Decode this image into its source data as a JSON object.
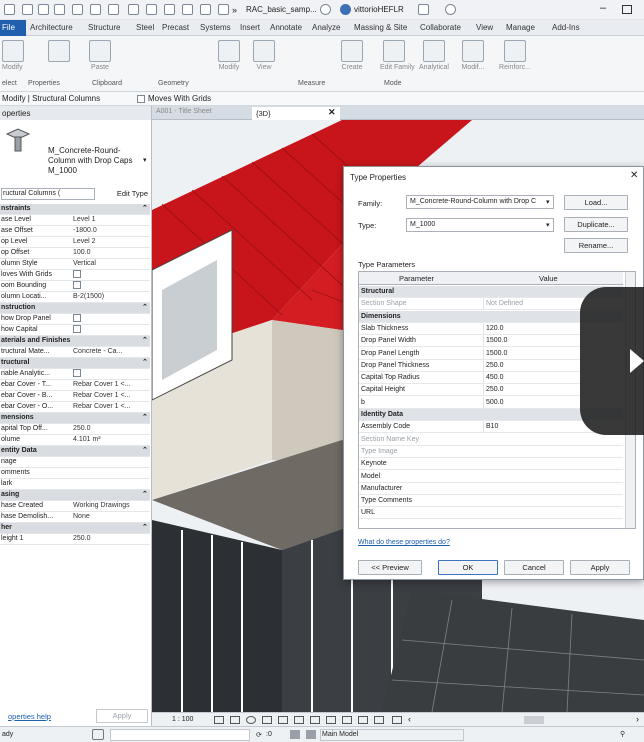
{
  "title_bar": {
    "doc_title": "RAC_basic_samp...",
    "user": "vittorioHEFLR"
  },
  "ribbon": {
    "tabs": [
      "File",
      "Architecture",
      "Structure",
      "Steel",
      "Precast",
      "Systems",
      "Insert",
      "Annotate",
      "Analyze",
      "Massing & Site",
      "Collaborate",
      "View",
      "Manage",
      "Add-Ins"
    ],
    "buttons": [
      "Modify",
      "Paste",
      "Modify",
      "View",
      "Create",
      "Edit Family",
      "Analytical",
      "Modif...",
      "Reinforc..."
    ],
    "groups": [
      "elect",
      "Properties",
      "Clipboard",
      "Geometry",
      "Measure",
      "Mode"
    ]
  },
  "context_bar": {
    "label": "Modify | Structural Columns",
    "option": "Moves With Grids"
  },
  "properties": {
    "header": "operties",
    "family_line1": "M_Concrete-Round-",
    "family_line2": "Column with Drop Caps",
    "family_line3": "M_1000",
    "filter": "ructural Columns (",
    "edit_type": "Edit Type",
    "rows": [
      {
        "label": "nstraints",
        "value": "",
        "kind": "hdr"
      },
      {
        "label": "ase Level",
        "value": "Level 1"
      },
      {
        "label": "ase Offset",
        "value": "-1800.0"
      },
      {
        "label": "op Level",
        "value": "Level 2"
      },
      {
        "label": "op Offset",
        "value": "100.0"
      },
      {
        "label": "olumn Style",
        "value": "Vertical"
      },
      {
        "label": "loves With Grids",
        "value": "",
        "kind": "chk"
      },
      {
        "label": "oom Bounding",
        "value": "",
        "kind": "chk"
      },
      {
        "label": "olumn Locati...",
        "value": "B-2(1500)"
      },
      {
        "label": "nstruction",
        "value": "",
        "kind": "hdr"
      },
      {
        "label": "how Drop Panel",
        "value": "",
        "kind": "chk"
      },
      {
        "label": "how Capital",
        "value": "",
        "kind": "chk"
      },
      {
        "label": "aterials and Finishes",
        "value": "",
        "kind": "hdr"
      },
      {
        "label": "tructural Mate...",
        "value": "Concrete - Ca..."
      },
      {
        "label": "tructural",
        "value": "",
        "kind": "hdr"
      },
      {
        "label": "nable Analytic...",
        "value": "",
        "kind": "chk"
      },
      {
        "label": "ebar Cover - T...",
        "value": "Rebar Cover 1 <..."
      },
      {
        "label": "ebar Cover - B...",
        "value": "Rebar Cover 1 <..."
      },
      {
        "label": "ebar Cover - O...",
        "value": "Rebar Cover 1 <..."
      },
      {
        "label": "mensions",
        "value": "",
        "kind": "hdr"
      },
      {
        "label": "apital Top Off...",
        "value": "250.0"
      },
      {
        "label": "olume",
        "value": "4.101 m²"
      },
      {
        "label": "entity Data",
        "value": "",
        "kind": "hdr"
      },
      {
        "label": "nage",
        "value": ""
      },
      {
        "label": "omments",
        "value": ""
      },
      {
        "label": "lark",
        "value": ""
      },
      {
        "label": "asing",
        "value": "",
        "kind": "hdr"
      },
      {
        "label": "hase Created",
        "value": "Working Drawings"
      },
      {
        "label": "hase Demolish...",
        "value": "None"
      },
      {
        "label": "her",
        "value": "",
        "kind": "hdr"
      },
      {
        "label": "leight 1",
        "value": "250.0"
      }
    ],
    "help_link": "operties help",
    "apply": "Apply"
  },
  "view_tabs": {
    "tab1": "A001 - Title Sheet",
    "tab2": "{3D}"
  },
  "dialog": {
    "title": "Type Properties",
    "family_label": "Family:",
    "family_value": "M_Concrete-Round-Column with Drop C",
    "type_label": "Type:",
    "type_value": "M_1000",
    "load": "Load...",
    "duplicate": "Duplicate...",
    "rename": "Rename...",
    "type_parameters": "Type Parameters",
    "col_parameter": "Parameter",
    "col_value": "Value",
    "rows": [
      {
        "p": "Structural",
        "v": "",
        "kind": "hdr"
      },
      {
        "p": "Section Shape",
        "v": "Not Defined",
        "kind": "gray"
      },
      {
        "p": "Dimensions",
        "v": "",
        "kind": "hdr"
      },
      {
        "p": "Slab Thickness",
        "v": "120.0"
      },
      {
        "p": "Drop Panel Width",
        "v": "1500.0"
      },
      {
        "p": "Drop Panel Length",
        "v": "1500.0"
      },
      {
        "p": "Drop Panel Thickness",
        "v": "250.0"
      },
      {
        "p": "Capital Top Radius",
        "v": "450.0"
      },
      {
        "p": "Capital Height",
        "v": "250.0"
      },
      {
        "p": "b",
        "v": "500.0"
      },
      {
        "p": "Identity Data",
        "v": "",
        "kind": "hdr"
      },
      {
        "p": "Assembly Code",
        "v": "B10"
      },
      {
        "p": "Section Name Key",
        "v": "",
        "kind": "gray"
      },
      {
        "p": "Type Image",
        "v": "",
        "kind": "gray"
      },
      {
        "p": "Keynote",
        "v": ""
      },
      {
        "p": "Model",
        "v": ""
      },
      {
        "p": "Manufacturer",
        "v": ""
      },
      {
        "p": "Type Comments",
        "v": ""
      },
      {
        "p": "URL",
        "v": ""
      }
    ],
    "help_link": "What do these properties do?",
    "preview": "<< Preview",
    "ok": "OK",
    "cancel": "Cancel",
    "apply": "Apply"
  },
  "view_control": {
    "scale": "1 : 100"
  },
  "status": {
    "left": "ady",
    "zero": ":0",
    "model": "Main Model"
  },
  "colors": {
    "roof_red": "#c8151b",
    "file_tab": "#1f5fae",
    "play_overlay": "#2a2a2a"
  }
}
